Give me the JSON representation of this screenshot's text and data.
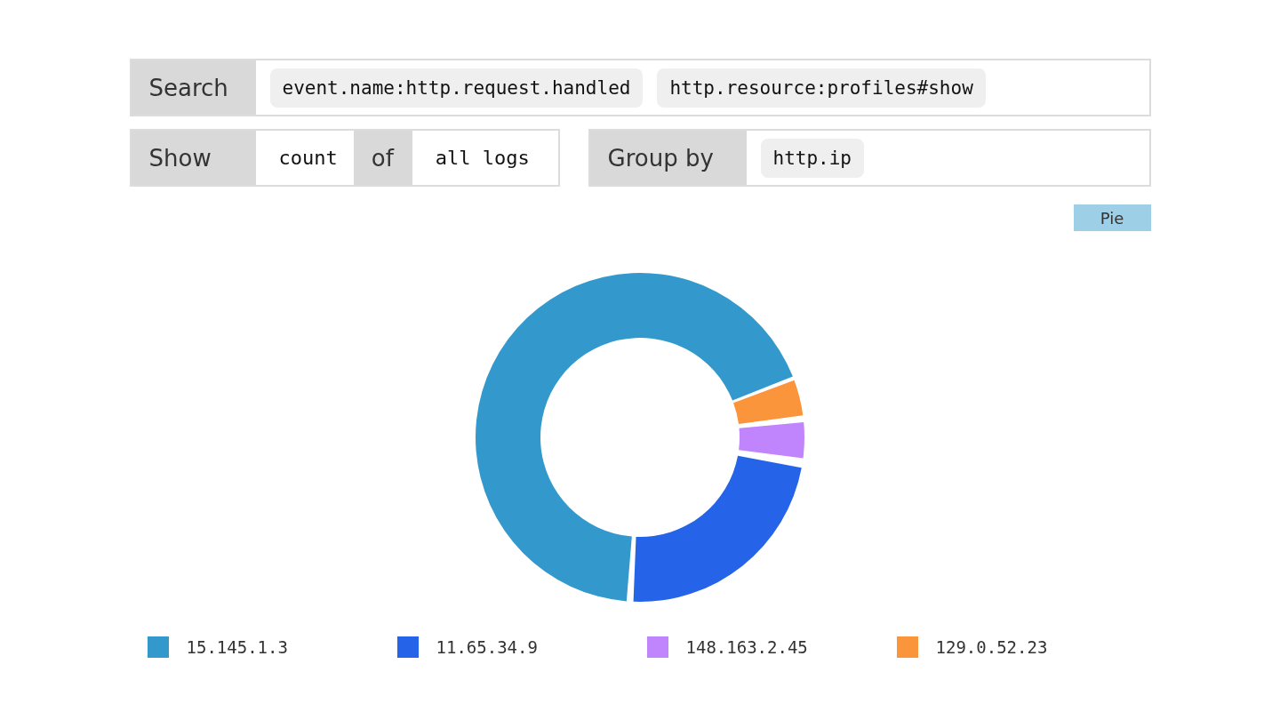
{
  "search": {
    "label": "Search",
    "terms": [
      "event.name:http.request.handled",
      "http.resource:profiles#show"
    ]
  },
  "show": {
    "label": "Show",
    "measure": "count",
    "connector": "of",
    "source": "all logs"
  },
  "group_by": {
    "label": "Group by",
    "fields": [
      "http.ip"
    ]
  },
  "chart_type_button": "Pie",
  "legend": [
    {
      "label": "15.145.1.3",
      "color": "#3399cc"
    },
    {
      "label": "11.65.34.9",
      "color": "#2563e8"
    },
    {
      "label": "148.163.2.45",
      "color": "#c084fc"
    },
    {
      "label": "129.0.52.23",
      "color": "#fb953b"
    }
  ]
}
